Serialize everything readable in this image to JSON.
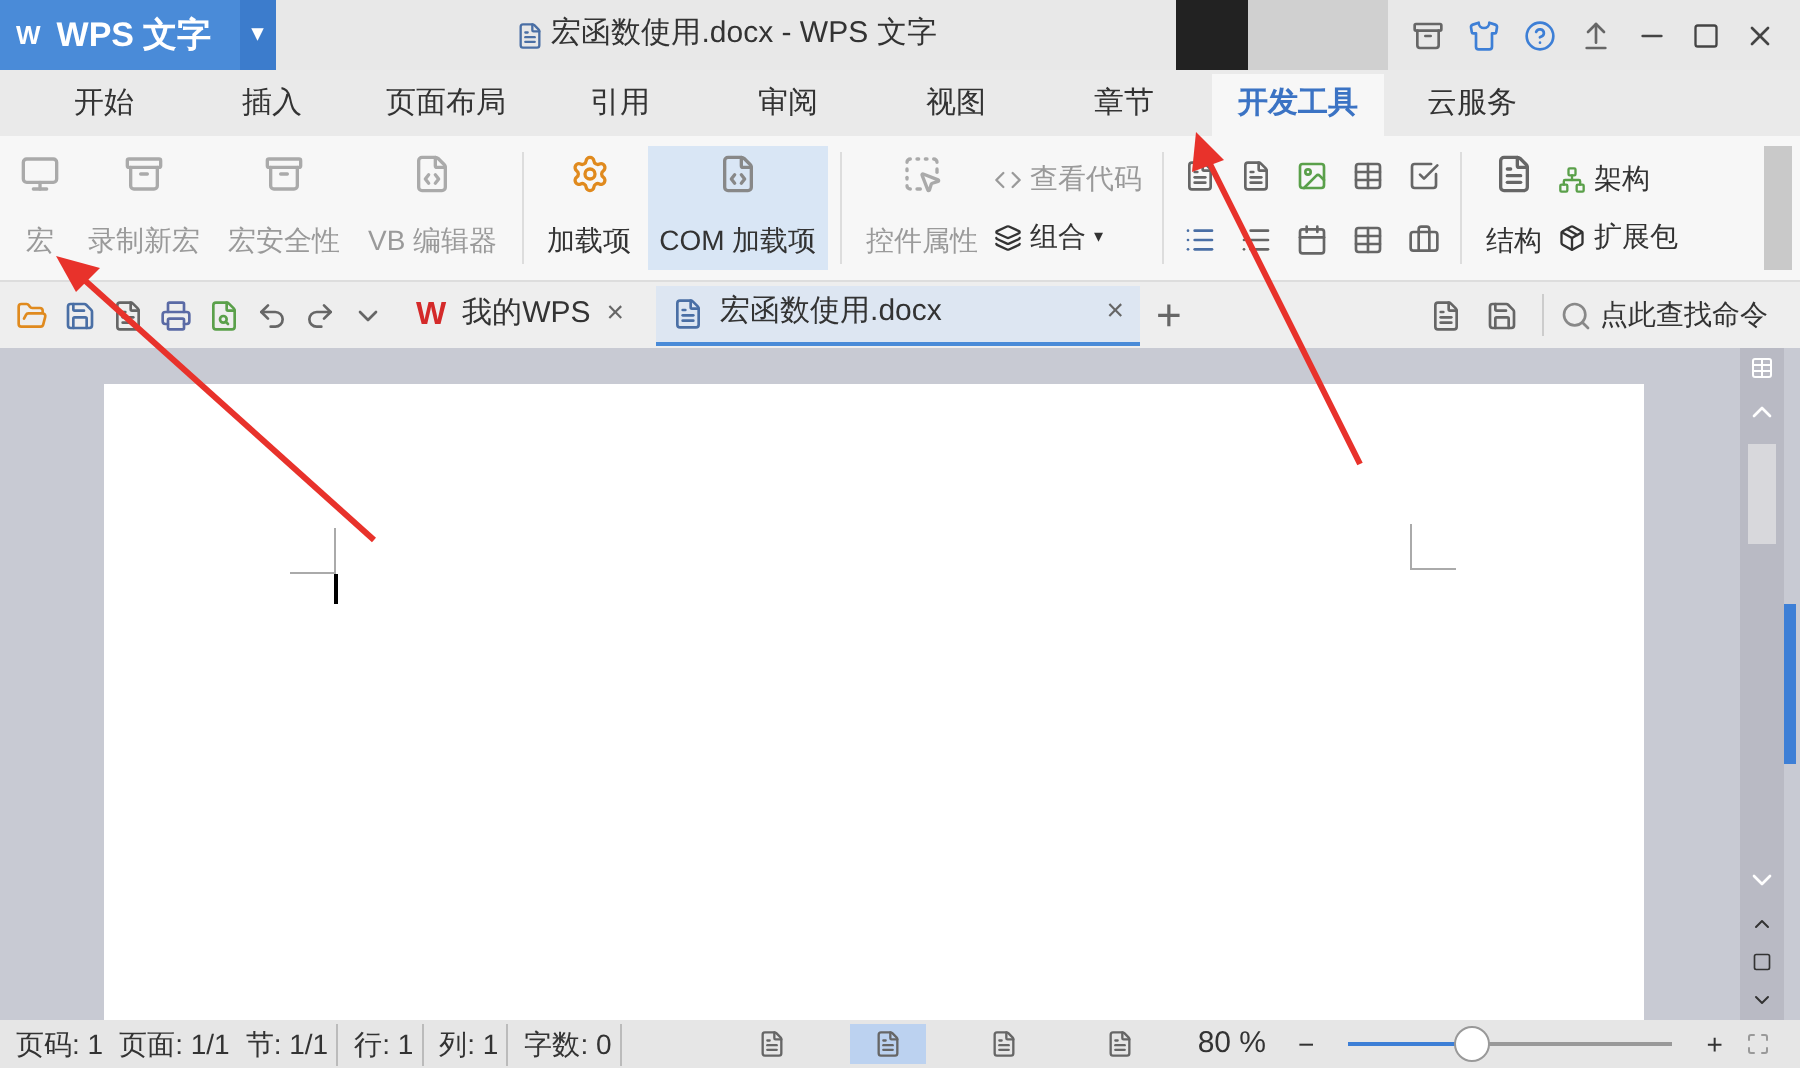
{
  "app_button": {
    "logo": "W",
    "label": "WPS 文字",
    "caret": "▾"
  },
  "window": {
    "title": "宏函数使用.docx - WPS 文字"
  },
  "menu_tabs": [
    {
      "label": "开始",
      "selected": false
    },
    {
      "label": "插入",
      "selected": false
    },
    {
      "label": "页面布局",
      "selected": false
    },
    {
      "label": "引用",
      "selected": false
    },
    {
      "label": "审阅",
      "selected": false
    },
    {
      "label": "视图",
      "selected": false
    },
    {
      "label": "章节",
      "selected": false
    },
    {
      "label": "开发工具",
      "selected": true
    },
    {
      "label": "云服务",
      "selected": false
    }
  ],
  "ribbon": {
    "macro_group": [
      {
        "label": "宏",
        "disabled": true
      },
      {
        "label": "录制新宏",
        "disabled": true
      },
      {
        "label": "宏安全性",
        "disabled": true
      },
      {
        "label": "VB 编辑器",
        "disabled": true
      }
    ],
    "addin_group": [
      {
        "label": "加载项",
        "selected": false
      },
      {
        "label": "COM 加载项",
        "selected": true
      }
    ],
    "control_group": {
      "properties": {
        "label": "控件属性",
        "disabled": true
      },
      "view_code": {
        "label": "查看代码",
        "disabled": true
      },
      "combine": {
        "label": "组合",
        "caret": "▾",
        "disabled": false
      }
    },
    "structure_group": {
      "structure": "结构",
      "schema": "架构",
      "expansion": "扩展包"
    }
  },
  "doc_tabs": [
    {
      "kind": "home",
      "logo": "W",
      "label": "我的WPS",
      "selected": false,
      "close": "×"
    },
    {
      "kind": "document",
      "label": "宏函数使用.docx",
      "selected": true,
      "close": "×"
    }
  ],
  "new_tab": "+",
  "search": {
    "placeholder": "点此查找命令"
  },
  "status_bar": {
    "fields": [
      "页码: 1",
      "页面: 1/1",
      "节: 1/1",
      "行: 1",
      "列: 1",
      "字数: 0"
    ],
    "views": [
      {
        "selected": false
      },
      {
        "selected": true
      },
      {
        "selected": false
      },
      {
        "selected": false
      }
    ],
    "zoom": "80 %",
    "zoom_minus": "−",
    "zoom_plus": "+",
    "zoom_slider": {
      "level": 0.38
    }
  }
}
